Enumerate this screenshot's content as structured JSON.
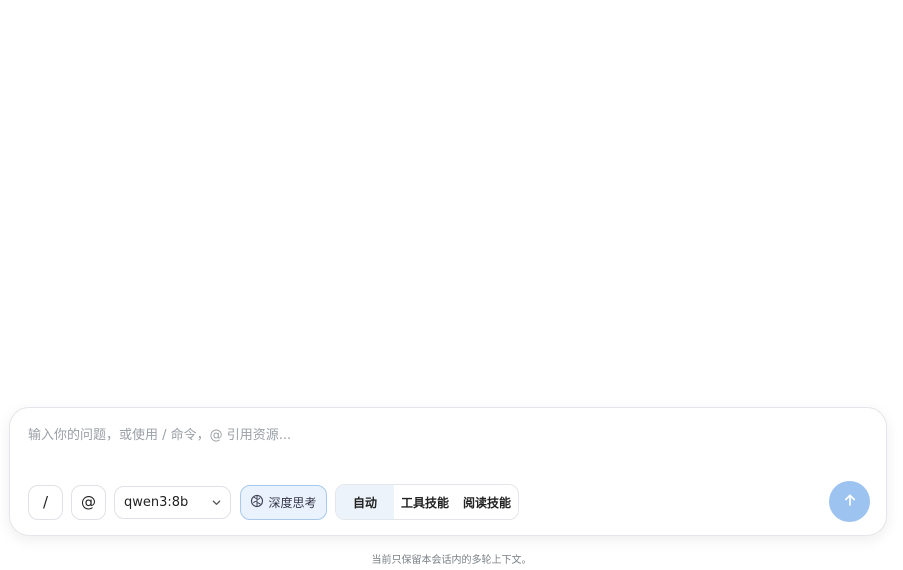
{
  "composer": {
    "placeholder": "输入你的问题，或使用 / 命令，@ 引用资源...",
    "input_value": ""
  },
  "toolbar": {
    "slash_label": "/",
    "mention_label": "@",
    "model": {
      "selected": "qwen3:8b",
      "icon": "chevron-down-icon"
    },
    "deep_think": {
      "label": "深度思考",
      "icon": "brain-icon",
      "active": true
    },
    "modes": [
      {
        "label": "自动",
        "active": true
      },
      {
        "label": "工具技能",
        "active": false
      },
      {
        "label": "阅读技能",
        "active": false
      }
    ]
  },
  "send": {
    "icon": "arrow-up-icon",
    "color": "#9dc3f1"
  },
  "footer": {
    "note": "当前只保留本会话内的多轮上下文。"
  },
  "colors": {
    "accent": "#9dc3f1",
    "think_bg": "#eaf3fd",
    "think_border": "#a9c9ec",
    "active_mode_bg": "#edf3fa"
  }
}
